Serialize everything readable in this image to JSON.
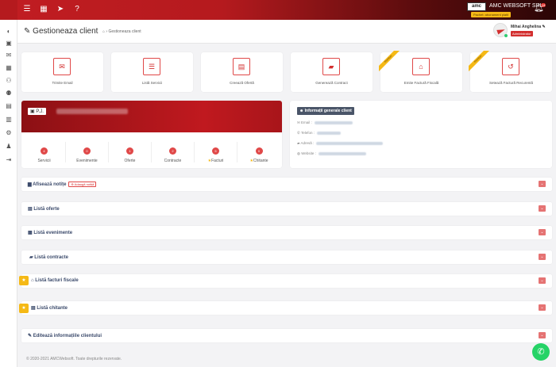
{
  "topbar": {
    "company_logo": "amc",
    "company_name": "AMC WEBSOFT SRL",
    "plan_badge": "Pachet: abonament platit",
    "notification_count": "14",
    "icons": [
      "menu-icon",
      "calendar-icon",
      "send-icon",
      "help-icon"
    ]
  },
  "header": {
    "title": "Gestioneaza client",
    "breadcrumb": "Gestioneaza client",
    "user_name": "Mihai Anghelina",
    "user_role": "Administrator"
  },
  "actions": [
    {
      "label": "Trimite Email",
      "icon": "envelope-icon",
      "ribbon": ""
    },
    {
      "label": "Listă Servicii",
      "icon": "list-icon",
      "ribbon": ""
    },
    {
      "label": "Creează Ofertă",
      "icon": "document-icon",
      "ribbon": ""
    },
    {
      "label": "Generează Contract",
      "icon": "folder-icon",
      "ribbon": ""
    },
    {
      "label": "Emite Factură Fiscală",
      "icon": "bank-icon",
      "ribbon": "Premium"
    },
    {
      "label": "Setează Factură Recurentă",
      "icon": "refresh-icon",
      "ribbon": "Premium"
    }
  ],
  "client": {
    "name_prefix": "P.J.",
    "stats": [
      {
        "count": "4",
        "label": "Servicii",
        "star": false
      },
      {
        "count": "0",
        "label": "Evenimente",
        "star": false
      },
      {
        "count": "1",
        "label": "Oferte",
        "star": false
      },
      {
        "count": "2",
        "label": "Contracte",
        "star": false
      },
      {
        "count": "5",
        "label": "Facturi",
        "star": true
      },
      {
        "count": "0",
        "label": "Chitante",
        "star": true
      }
    ]
  },
  "info": {
    "title": "Informații generale client",
    "email_label": "Email :",
    "phone_label": "Telefon :",
    "address_label": "Adresă :",
    "website_label": "Website :"
  },
  "sections": {
    "notes": "Afisează notițe",
    "add_note": "Adaugă notiță",
    "offers": "Listă oferte",
    "events": "Listă evenimente",
    "contracts": "Listă contracte",
    "invoices": "Listă facturi fiscale",
    "receipts": "Listă chitante",
    "edit": "Editează informațiile clientului"
  },
  "footer": {
    "copyright": "© 2020-2021 AMCWebsoft. Toate drepturile rezervate."
  },
  "colors": {
    "accent": "#d32f2f",
    "premium": "#f5b916",
    "section_title": "#3b4a6b",
    "whatsapp": "#25d366"
  }
}
